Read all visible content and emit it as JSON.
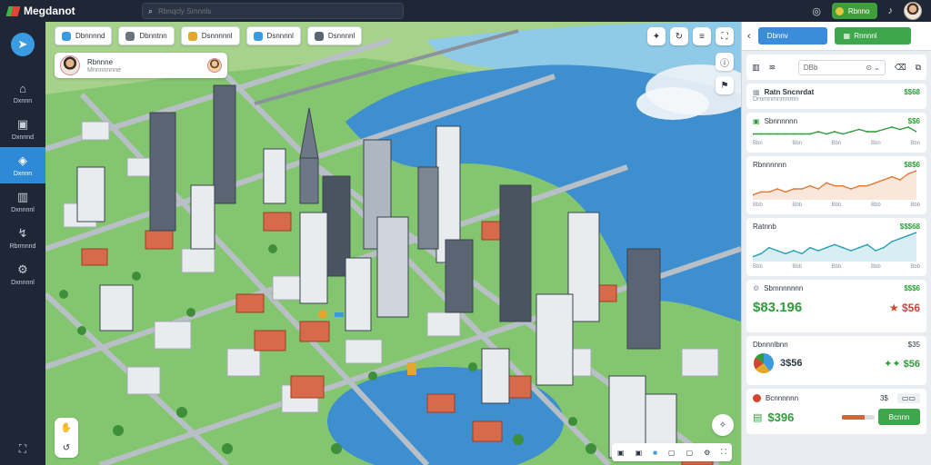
{
  "app": {
    "title": "Megdanot"
  },
  "search": {
    "placeholder": "Rbnqcly Srnnnls"
  },
  "topbar": {
    "action_label": "Rbnno"
  },
  "sidebar": {
    "items": [
      {
        "icon": "home-icon",
        "label": "Dxnnn"
      },
      {
        "icon": "dashboard-icon",
        "label": "Dxnnnd"
      },
      {
        "icon": "map-layers-icon",
        "label": "Dxnnn",
        "active": true
      },
      {
        "icon": "building-icon",
        "label": "Dxnnnnl"
      },
      {
        "icon": "analytics-icon",
        "label": "Rbrmnnd"
      },
      {
        "icon": "settings-icon",
        "label": "Dxnnnnl"
      }
    ]
  },
  "map": {
    "chips": [
      {
        "label": "Dbnnnnd",
        "color": "#3a9be0"
      },
      {
        "label": "Dbnntnn",
        "color": "#6c7480"
      },
      {
        "label": "Dsnnnnnl",
        "color": "#e3a82b"
      },
      {
        "label": "Dsnnnnl",
        "color": "#3a9be0"
      },
      {
        "label": "Dsnnnnl",
        "color": "#5b6472"
      }
    ],
    "user_card": {
      "label": "Rbnnne",
      "sublabel": "Mnnnnnnne"
    },
    "status_items": [
      "B",
      "B",
      "B",
      "B",
      "B",
      "B"
    ]
  },
  "panel": {
    "primary_button": "Dbnnv",
    "secondary_button": "Rnnnnl",
    "select_label": "DBb",
    "cards": [
      {
        "title": "Ratn Sncnrdat",
        "value": "$$68",
        "sub": "Drnmnmnmnmn",
        "sub_value": ""
      },
      {
        "title": "Sbnnnnnn",
        "value": "$$6",
        "chart": {
          "type": "line",
          "color": "#2e9d3a",
          "values": [
            3,
            3,
            3,
            3,
            3,
            3,
            3,
            3,
            4,
            3,
            4,
            3,
            4,
            5,
            4,
            4,
            5,
            6,
            5,
            6,
            4
          ],
          "ticks": [
            "Bbn",
            "Bbn",
            "Bbn",
            "Bbn",
            "Bbn"
          ]
        }
      },
      {
        "title": "Rbnnnnnn",
        "value": "$8$6",
        "chart": {
          "type": "area",
          "color": "#e07a3a",
          "values": [
            2,
            3,
            3,
            4,
            3,
            4,
            4,
            5,
            4,
            6,
            5,
            5,
            4,
            5,
            5,
            6,
            7,
            8,
            7,
            9,
            10
          ],
          "ticks": [
            "Bbb",
            "Bbb",
            "Bbb",
            "Bbb",
            "Bbb"
          ]
        }
      },
      {
        "title": "Ratnnb",
        "value": "$$$68",
        "chart": {
          "type": "area",
          "color": "#2b9fb5",
          "values": [
            2,
            3,
            5,
            4,
            3,
            4,
            3,
            5,
            4,
            5,
            6,
            5,
            4,
            5,
            6,
            4,
            5,
            7,
            8,
            9,
            10
          ],
          "ticks": [
            "Bbb",
            "Bbb",
            "Bbb",
            "Bbb",
            "Bbb"
          ]
        }
      },
      {
        "title": "Sbmnnnnnn",
        "value": "$$$6",
        "big_value": "$83.196",
        "big_right": "$56",
        "big_value2": ""
      },
      {
        "title": "Dbnnnlbnn",
        "value": "$35",
        "big_value": "3$56",
        "right": "$56",
        "pie": [
          40,
          25,
          20,
          15
        ],
        "pie_colors": [
          "#3a9be0",
          "#e3a82b",
          "#d2452f",
          "#2e9d3a"
        ]
      },
      {
        "title": "Bcnnnnnn",
        "value": "3$",
        "big_value": "$396",
        "button": "Bcnnn",
        "progress": 0.7
      }
    ]
  }
}
